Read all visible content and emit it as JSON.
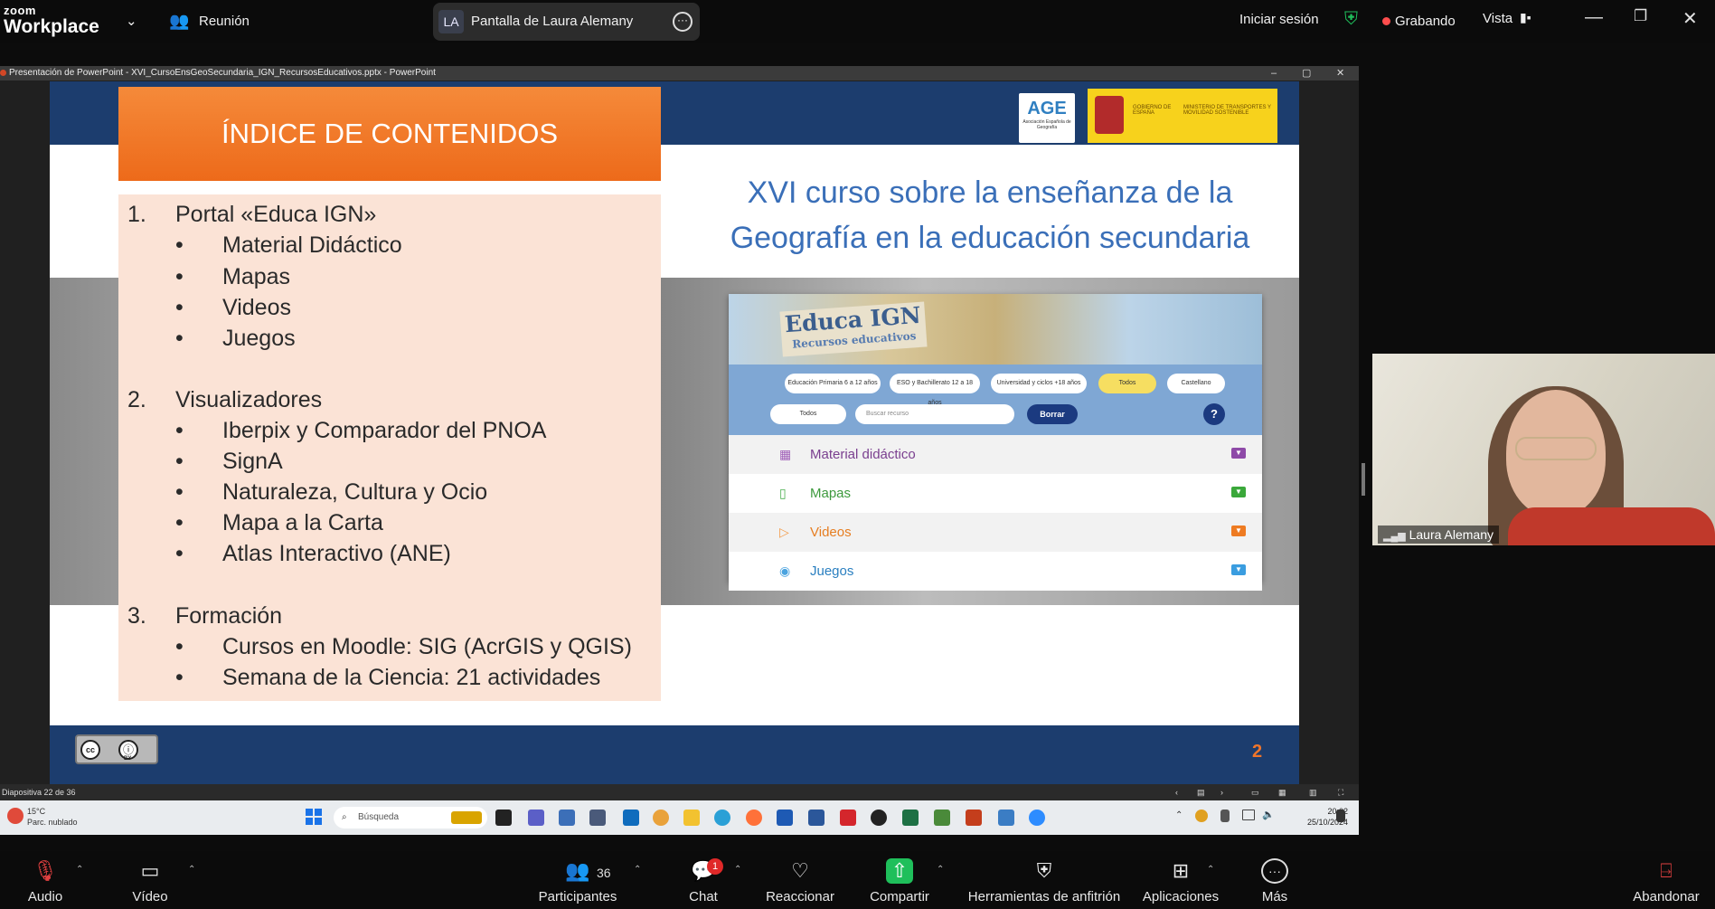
{
  "topbar": {
    "brand_small": "zoom",
    "brand_big": "Workplace",
    "meeting_label": "Reunión",
    "share_badge": "LA",
    "share_title": "Pantalla de Laura Alemany",
    "signin": "Iniciar sesión",
    "recording": "Grabando",
    "view": "Vista"
  },
  "ppt": {
    "title": "Presentación de PowerPoint  -  XVI_CursoEnsGeoSecundaria_IGN_RecursosEducativos.pptx - PowerPoint",
    "status": "Diapositiva 22 de 36"
  },
  "slide": {
    "index_title": "ÍNDICE DE CONTENIDOS",
    "main_title_1": "XVI curso sobre la enseñanza de la",
    "main_title_2": "Geografía en la educación secundaria",
    "age_logo": "AGE",
    "age_sub": "Asociación Española de Geografía",
    "gob_1": "GOBIERNO DE ESPAÑA",
    "gob_2": "MINISTERIO DE TRANSPORTES Y MOVILIDAD SOSTENIBLE",
    "page_number": "2",
    "cc_label": "BY",
    "index": {
      "s1_num": "1.",
      "s1_title": "Portal «Educa IGN»",
      "s1_items": [
        "Material Didáctico",
        "Mapas",
        "Videos",
        "Juegos"
      ],
      "s2_num": "2.",
      "s2_title": "Visualizadores",
      "s2_items": [
        "Iberpix y Comparador del PNOA",
        "SignA",
        "Naturaleza, Cultura y Ocio",
        "Mapa a la Carta",
        "Atlas Interactivo (ANE)"
      ],
      "s3_num": "3.",
      "s3_title": "Formación",
      "s3_items": [
        "Cursos en Moodle: SIG (AcrGIS y QGIS)",
        "Semana de la Ciencia: 21 actividades"
      ]
    },
    "educa": {
      "logo": "Educa IGN",
      "logo_sub": "Recursos educativos",
      "pill_1": "Educación Primaria 6 a 12 años",
      "pill_2": "ESO y Bachillerato 12 a 18 años",
      "pill_3": "Universidad y ciclos +18 años",
      "pill_4": "Todos",
      "pill_5": "Castellano",
      "select": "Todos",
      "search_placeholder": "Buscar recurso",
      "clear": "Borrar",
      "help": "?",
      "rows": [
        "Material didáctico",
        "Mapas",
        "Videos",
        "Juegos"
      ]
    }
  },
  "taskbar": {
    "temp": "15°C",
    "weather": "Parc. nublado",
    "search": "Búsqueda",
    "time": "20:02",
    "date": "25/10/2024"
  },
  "video": {
    "name": "Laura Alemany"
  },
  "bottombar": {
    "audio": "Audio",
    "video": "Vídeo",
    "participants": "Participantes",
    "participants_count": "36",
    "chat": "Chat",
    "chat_badge": "1",
    "react": "Reaccionar",
    "share": "Compartir",
    "host_tools": "Herramientas de anfitrión",
    "apps": "Aplicaciones",
    "more": "Más",
    "leave": "Abandonar"
  },
  "colors": {
    "slide_band": "#1c3d6e",
    "index_orange": "#ef7224",
    "index_bg": "#fbe3d6",
    "title_blue": "#3a6fb8",
    "recording_red": "#ff4d4d",
    "share_green": "#1fbf5b"
  }
}
